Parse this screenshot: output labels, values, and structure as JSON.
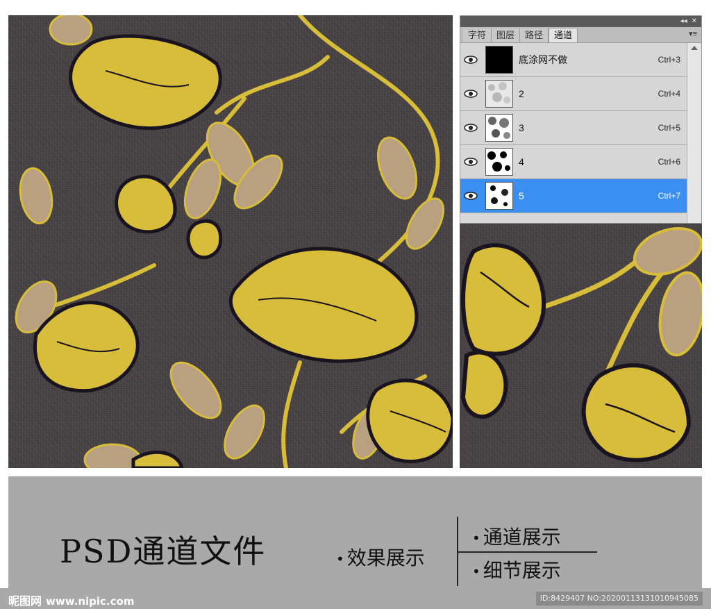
{
  "panel": {
    "tabs": [
      {
        "label": "字符"
      },
      {
        "label": "图层"
      },
      {
        "label": "路径"
      },
      {
        "label": "通道"
      }
    ],
    "active_tab": "通道",
    "titlebar_icons": [
      "collapse-icon",
      "close-icon"
    ],
    "menu_icon": "panel-menu-icon",
    "channels": [
      {
        "name": "底涂网不做",
        "shortcut": "Ctrl+3",
        "thumb": "black"
      },
      {
        "name": "2",
        "shortcut": "Ctrl+4",
        "thumb": "light-noise"
      },
      {
        "name": "3",
        "shortcut": "Ctrl+5",
        "thumb": "medium-blobs"
      },
      {
        "name": "4",
        "shortcut": "Ctrl+6",
        "thumb": "dark-blobs"
      },
      {
        "name": "5",
        "shortcut": "Ctrl+7",
        "thumb": "sparse-blobs"
      }
    ],
    "selected_channel": "5",
    "selection_color": "#3a8ff0"
  },
  "banner": {
    "title": "PSD通道文件",
    "effect_label": "效果展示",
    "channel_label": "通道展示",
    "detail_label": "细节展示"
  },
  "watermark": {
    "brand": "昵图网",
    "url": "www.nipic.com",
    "id_text": "ID:8429407 NO:20200113131010945085"
  },
  "colors": {
    "fabric": "#4a4446",
    "flower_gold": "#d8bd3a",
    "flower_outline": "#1a1420",
    "leaf_tan": "#b8a080",
    "banner_gray": "#a9a9a9"
  }
}
